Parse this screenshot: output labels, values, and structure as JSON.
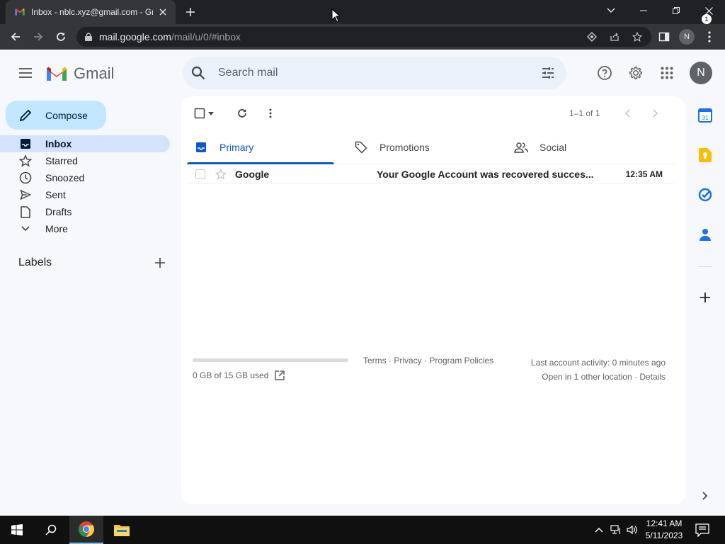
{
  "browser": {
    "tab_title": "Inbox - nblc.xyz@gmail.com - Gmail",
    "url_host": "mail.google.com",
    "url_path": "/mail/u/0/#inbox",
    "profile_initial": "N"
  },
  "gmail": {
    "logo_text": "Gmail",
    "search_placeholder": "Search mail",
    "avatar_initial": "N",
    "compose_label": "Compose",
    "nav": [
      {
        "label": "Inbox",
        "icon": "inbox-icon",
        "active": true
      },
      {
        "label": "Starred",
        "icon": "star-icon"
      },
      {
        "label": "Snoozed",
        "icon": "clock-icon"
      },
      {
        "label": "Sent",
        "icon": "send-icon"
      },
      {
        "label": "Drafts",
        "icon": "draft-icon"
      },
      {
        "label": "More",
        "icon": "chevron-down-icon"
      }
    ],
    "labels_title": "Labels",
    "pager": "1–1 of 1",
    "tabs": [
      {
        "label": "Primary",
        "icon": "inbox-icon",
        "active": true
      },
      {
        "label": "Promotions",
        "icon": "tag-icon"
      },
      {
        "label": "Social",
        "icon": "people-icon"
      }
    ],
    "emails": [
      {
        "sender": "Google",
        "subject": "Your Google Account was recovered succes...",
        "time": "12:35 AM"
      }
    ],
    "footer": {
      "storage": "0 GB of 15 GB used",
      "storage_fraction": 0,
      "links": "Terms · Privacy · Program Policies",
      "activity": "Last account activity: 0 minutes ago",
      "other_location": "Open in 1 other location · Details"
    }
  },
  "taskbar": {
    "time": "12:41 AM",
    "date": "5/11/2023",
    "notification_count": "1"
  },
  "colors": {
    "accent": "#0b57d0",
    "compose_bg": "#c2e7ff",
    "active_nav_bg": "#d3e3fd"
  }
}
